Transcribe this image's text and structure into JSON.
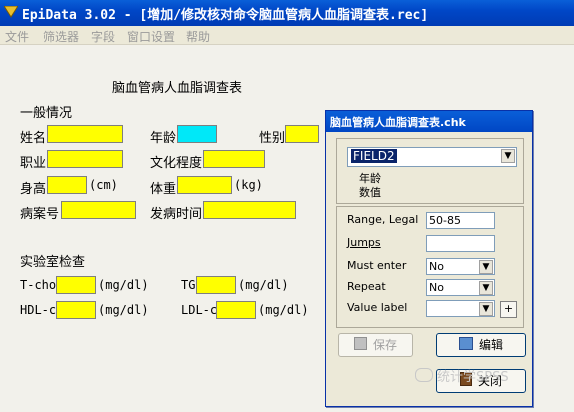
{
  "window": {
    "title": "EpiData 3.02 - [增加/修改核对命令脑血管病人血脂调查表.rec]"
  },
  "menu": [
    "文件",
    "筛选器",
    "字段",
    "窗口设置",
    "帮助"
  ],
  "form": {
    "title": "脑血管病人血脂调查表",
    "section_general": "一般情况",
    "fields": {
      "name": "姓名",
      "age": "年龄",
      "sex": "性别",
      "job": "职业",
      "education": "文化程度",
      "height": "身高",
      "height_unit": "(cm)",
      "weight": "体重",
      "weight_unit": "(kg)",
      "case_no": "病案号",
      "onset_time": "发病时间"
    },
    "section_lab": "实验室检查",
    "lab": {
      "tcho": "T-cho",
      "tcho_unit": "(mg/dl)",
      "tg": "TG",
      "tg_unit": "(mg/dl)",
      "hdl": "HDL-c",
      "hdl_unit": "(mg/dl)",
      "ldl": "LDL-c",
      "ldl_unit": "(mg/dl)"
    }
  },
  "dialog": {
    "title": "脑血管病人血脂调查表.chk",
    "field_select": "FIELD2",
    "field_info_1": "年龄",
    "field_info_2": "数值",
    "props": [
      {
        "label": "Range, Legal",
        "value": "50-85"
      },
      {
        "label": "Jumps",
        "value": ""
      },
      {
        "label": "Must enter",
        "value": "No"
      },
      {
        "label": "Repeat",
        "value": "No"
      },
      {
        "label": "Value label",
        "value": ""
      }
    ],
    "plus_label": "+",
    "save_label": "保存",
    "edit_label": "编辑",
    "close_label": "关闭"
  },
  "watermark": "统计学SPSS",
  "colors": {
    "title_bar": "#0047c7",
    "field_fill": "#ffff00",
    "active_field": "#00e8f8"
  }
}
